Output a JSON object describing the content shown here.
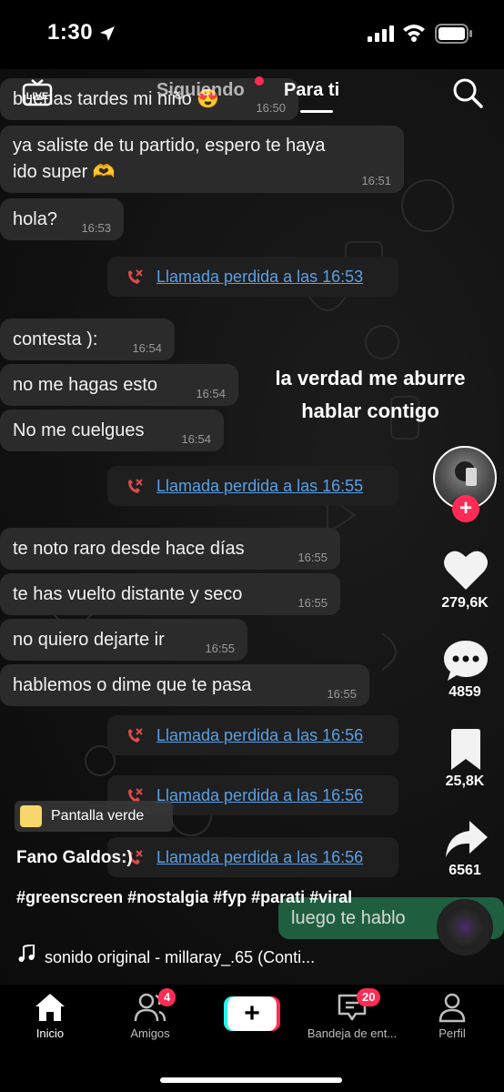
{
  "status_bar": {
    "time": "1:30"
  },
  "top_nav": {
    "following": "Siguiendo",
    "for_you": "Para ti",
    "live": "LIVE"
  },
  "chat": {
    "messages": [
      {
        "text": "buenas tardes mi niño 😍",
        "time": "16:50"
      },
      {
        "text": "ya saliste de tu partido, espero te haya ido super 🫶",
        "time": "16:51"
      },
      {
        "text": "hola?",
        "time": "16:53"
      },
      {
        "text": "contesta ):",
        "time": "16:54"
      },
      {
        "text": "no me hagas esto",
        "time": "16:54"
      },
      {
        "text": "No me cuelgues",
        "time": "16:54"
      },
      {
        "text": "te noto raro desde hace días",
        "time": "16:55"
      },
      {
        "text": "te has vuelto distante y seco",
        "time": "16:55"
      },
      {
        "text": "no quiero dejarte ir",
        "time": "16:55"
      },
      {
        "text": "hablemos o dime que te pasa",
        "time": "16:55"
      }
    ],
    "missed_calls": [
      "Llamada perdida a las 16:53",
      "Llamada perdida a las 16:55",
      "Llamada perdida a las 16:56",
      "Llamada perdida a las 16:56",
      "Llamada perdida a las 16:56"
    ],
    "reply": "luego te hablo"
  },
  "overlay_text": "la verdad me aburre hablar contigo",
  "rail": {
    "likes": "279,6K",
    "comments": "4859",
    "saves": "25,8K",
    "shares": "6561"
  },
  "effect": "Pantalla verde",
  "username": "Fano Galdos:)",
  "caption": "#greenscreen #nostalgia #fyp #parati #viral",
  "sound": "sonido original - millaray_.65 (Conti...",
  "tabs": {
    "home": "Inicio",
    "friends": "Amigos",
    "friends_badge": "4",
    "inbox": "Bandeja de ent...",
    "inbox_badge": "20",
    "profile": "Perfil"
  },
  "colors": {
    "accent_red": "#fe2c55",
    "accent_cyan": "#25f4ee",
    "link_blue": "#5aa0e6"
  }
}
